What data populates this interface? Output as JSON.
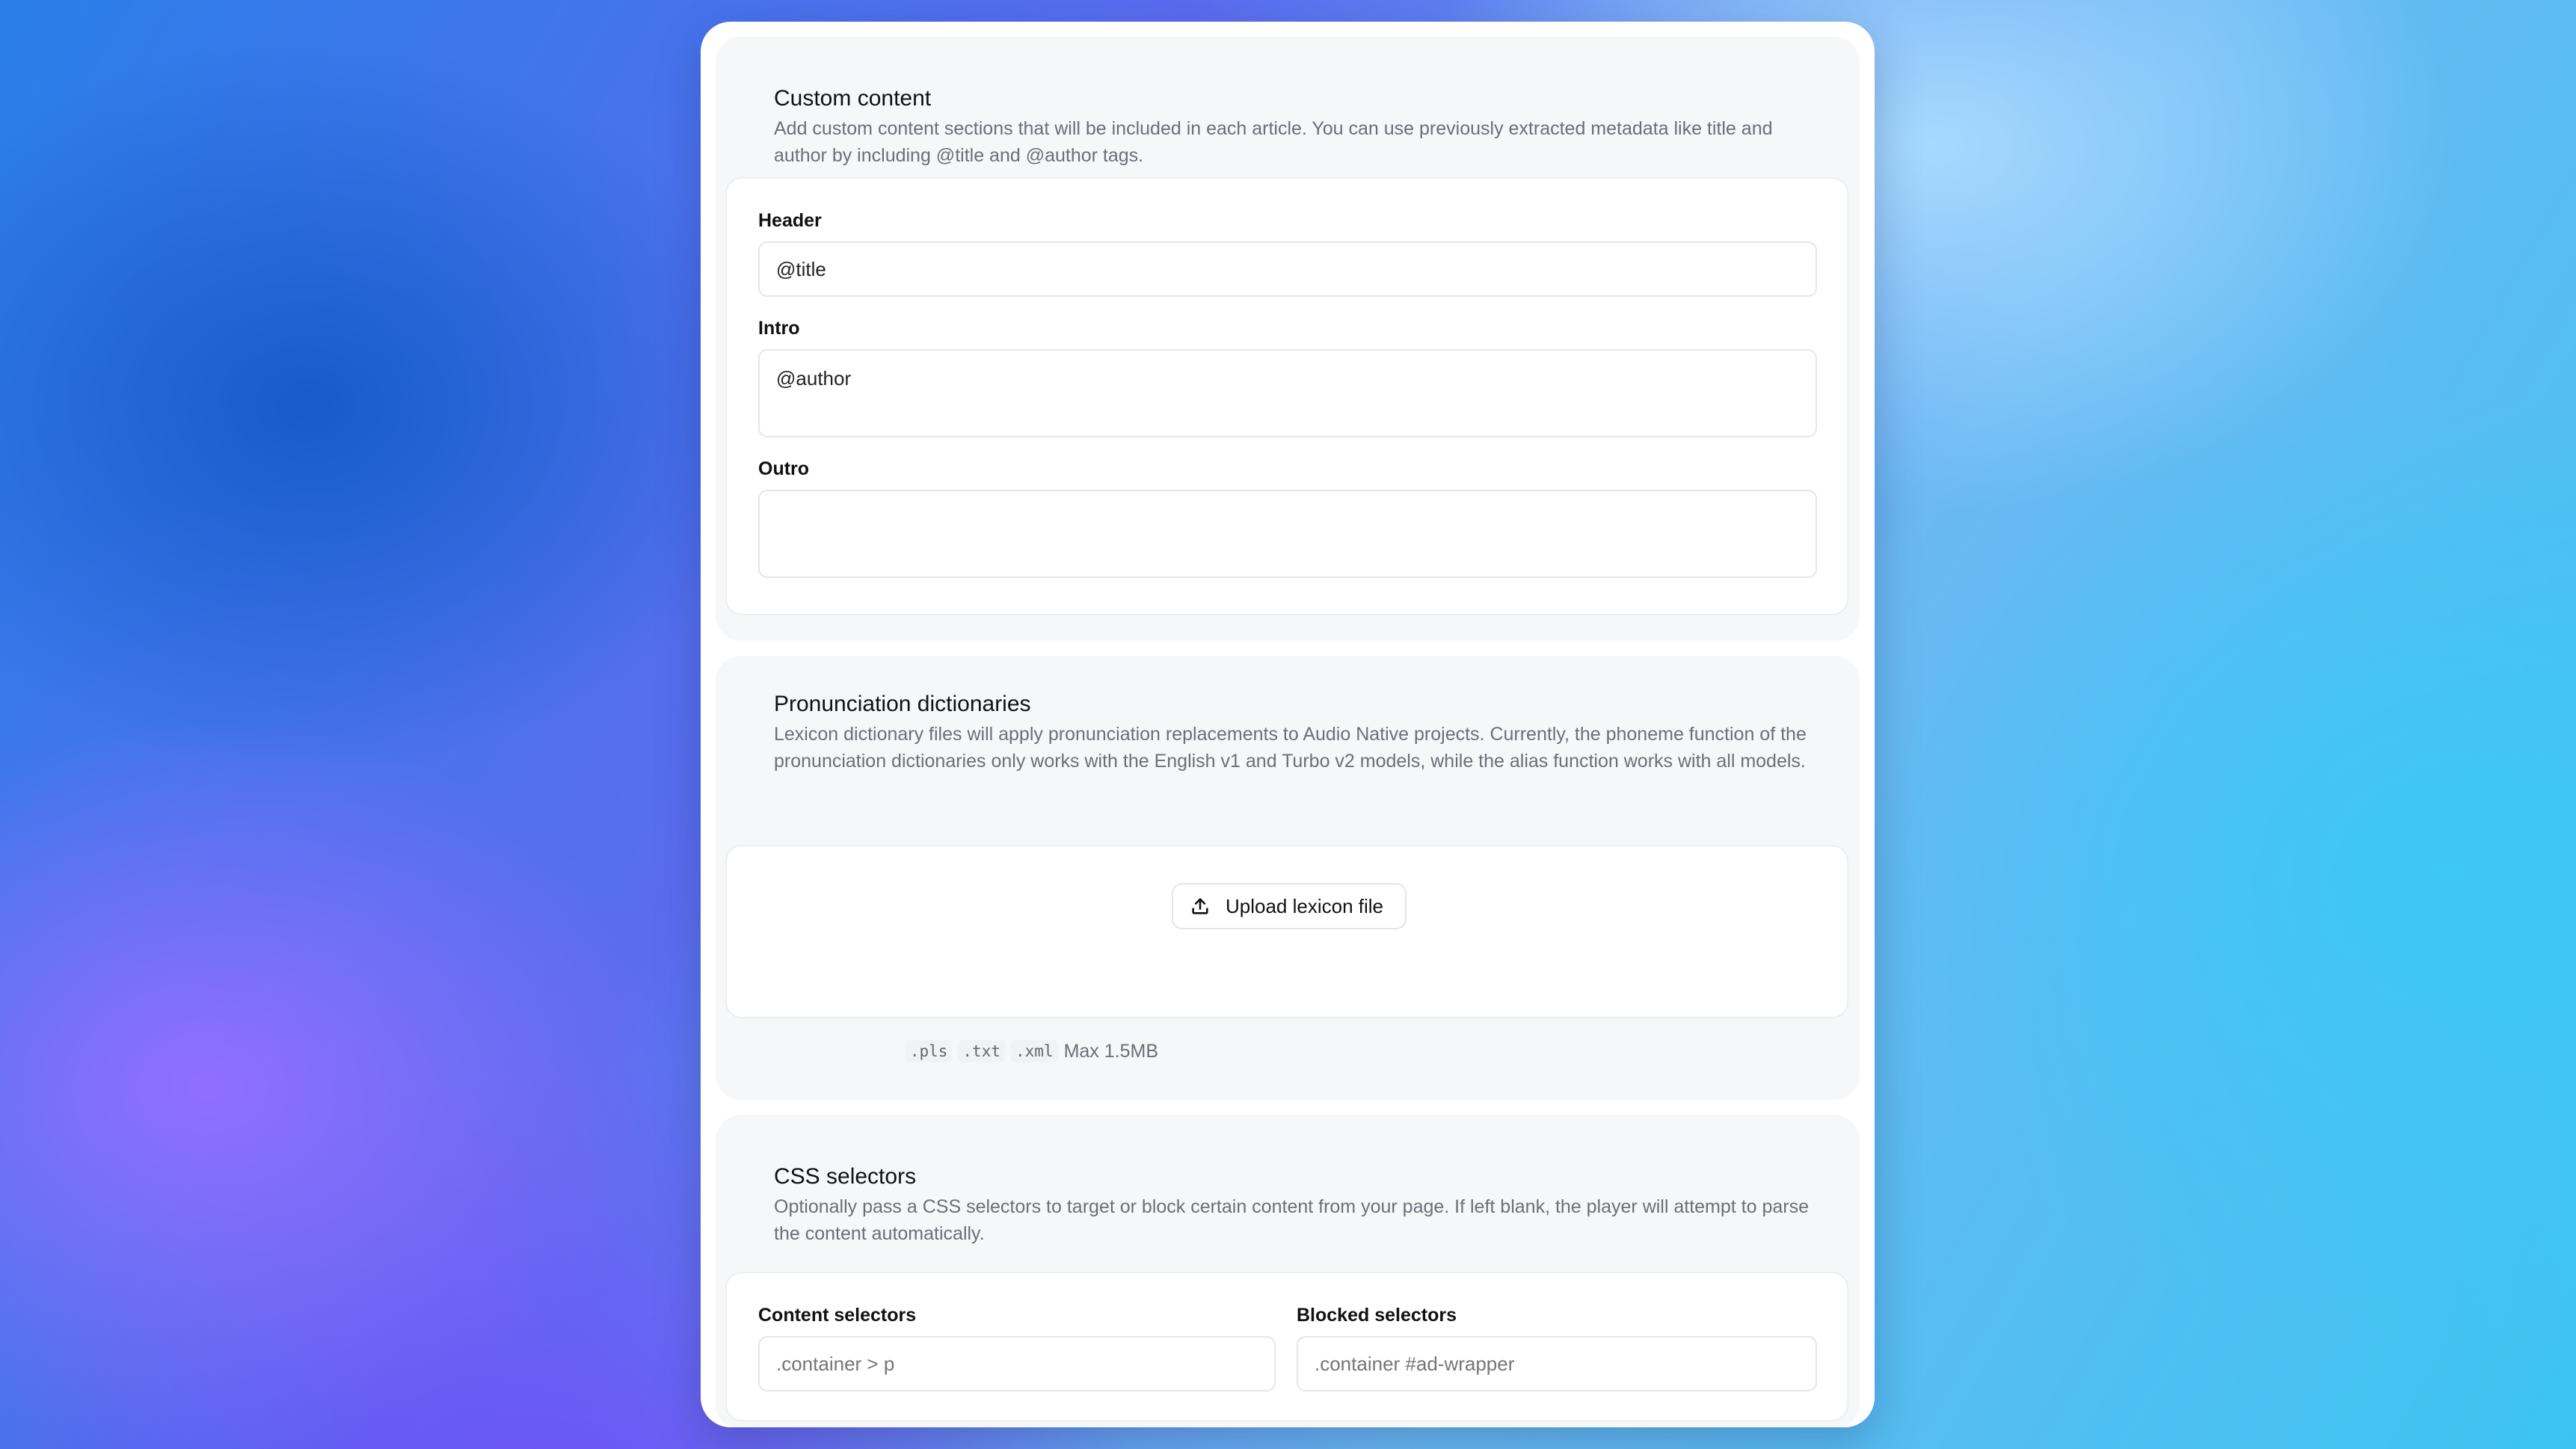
{
  "custom_content": {
    "title": "Custom content",
    "description": "Add custom content sections that will be included in each article. You can use previously extracted metadata like title and author by including @title and @author tags.",
    "header_label": "Header",
    "header_value": "@title",
    "intro_label": "Intro",
    "intro_value": "@author",
    "outro_label": "Outro",
    "outro_value": ""
  },
  "pronunciation": {
    "title": "Pronunciation dictionaries",
    "description": "Lexicon dictionary files will apply pronunciation replacements to Audio Native projects. Currently, the phoneme function of the pronunciation dictionaries only works with the English v1 and Turbo v2 models, while the alias function works with all models.",
    "upload_label": "Upload lexicon file",
    "formats": [
      ".pls",
      ".txt",
      ".xml"
    ],
    "max_size": "Max 1.5MB"
  },
  "css_selectors": {
    "title": "CSS selectors",
    "description": "Optionally pass a CSS selectors to target or block certain content from your page. If left blank, the player will attempt to parse the content automatically.",
    "content_label": "Content selectors",
    "content_placeholder": ".container > p",
    "blocked_label": "Blocked selectors",
    "blocked_placeholder": ".container #ad-wrapper"
  }
}
